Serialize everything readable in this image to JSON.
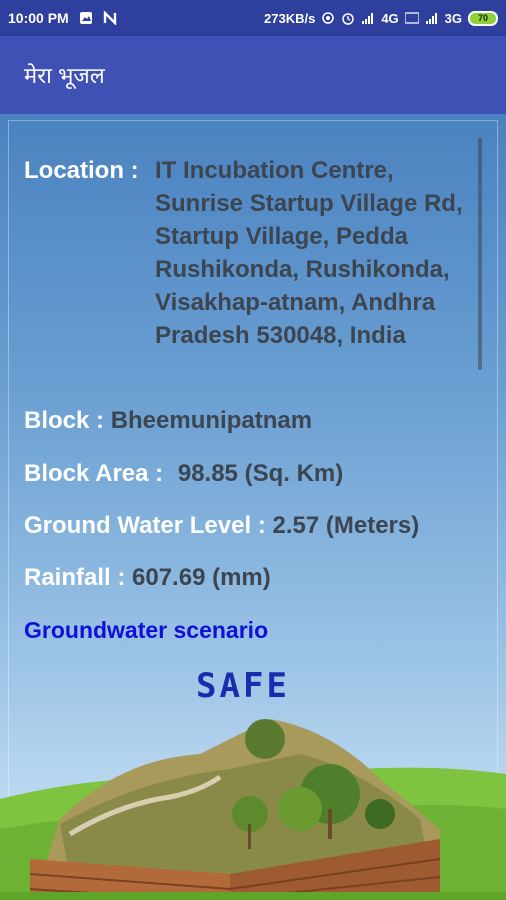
{
  "status_bar": {
    "time": "10:00 PM",
    "network_speed": "273KB/s",
    "signal1": "4G",
    "signal2": "3G",
    "battery": "70"
  },
  "app_bar": {
    "title": "मेरा भूजल"
  },
  "details": {
    "location_label": "Location :",
    "location_value": "IT Incubation Centre, Sunrise Startup Village Rd, Startup Village, Pedda Rushikonda, Rushikonda, Visakhap-atnam, Andhra Pradesh 530048, India",
    "block_label": "Block :",
    "block_value": "Bheemunipatnam",
    "block_area_label": "Block Area :",
    "block_area_value": "98.85 (Sq. Km)",
    "gwl_label": "Ground Water Level :",
    "gwl_value": "2.57 (Meters)",
    "rainfall_label": "Rainfall :",
    "rainfall_value": "607.69 (mm)"
  },
  "scenario": {
    "link_label": "Groundwater scenario",
    "status": "SAFE"
  },
  "colors": {
    "primary": "#3f51b5",
    "status_bar": "#2f3f9e",
    "link": "#1010d8",
    "safe": "#1a2bb0"
  }
}
